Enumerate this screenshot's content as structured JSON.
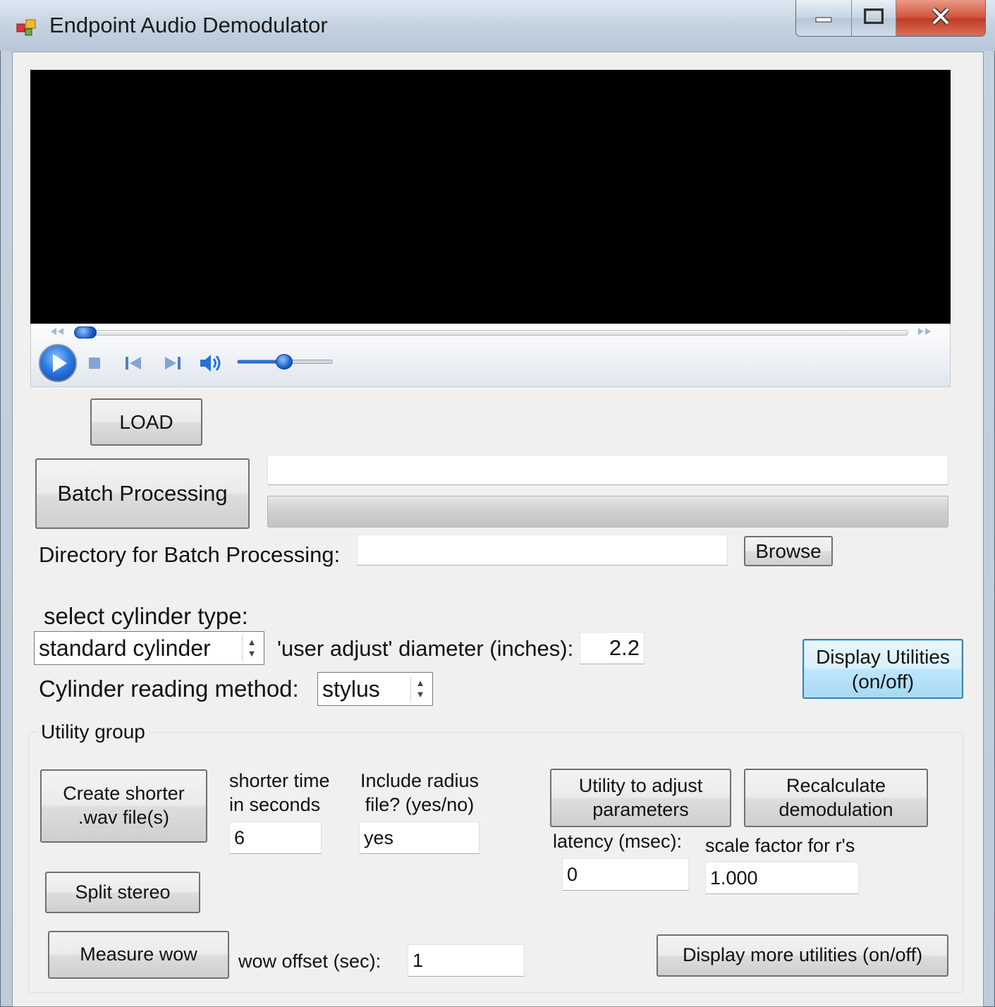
{
  "window": {
    "title": "Endpoint Audio Demodulator",
    "buttons": {
      "minimize": "minimize-icon",
      "maximize": "maximize-icon",
      "close": "close-icon"
    }
  },
  "player": {
    "icons": [
      "rewind-icon",
      "fast-forward-icon",
      "play-icon",
      "stop-icon",
      "previous-icon",
      "next-icon",
      "volume-icon"
    ],
    "seek_level": 0.01,
    "volume_level": 0.5,
    "accent_color": "#1d5fc9"
  },
  "load_button": "LOAD",
  "batch": {
    "button": "Batch Processing",
    "status_value": "",
    "progress_level": 0,
    "directory_label": "Directory for Batch Processing:",
    "directory_value": "",
    "browse_button": "Browse"
  },
  "cylinder": {
    "select_label": "select cylinder type:",
    "type_value": "standard cylinder",
    "diameter_label": "'user adjust' diameter (inches):",
    "diameter_value": "2.2",
    "method_label": "Cylinder reading method:",
    "method_value": "stylus"
  },
  "display_utilities_button": [
    "Display Utilities",
    "(on/off)"
  ],
  "utility_group": {
    "caption": "Utility group",
    "create_shorter_button": [
      "Create shorter",
      ".wav file(s)"
    ],
    "shorter_time_label": [
      "shorter time",
      "in seconds"
    ],
    "shorter_time_value": "6",
    "include_radius_label": [
      "Include radius",
      "file? (yes/no)"
    ],
    "include_radius_value": "yes",
    "adjust_parameters_button": [
      "Utility to adjust",
      "parameters"
    ],
    "recalculate_button": [
      "Recalculate",
      "demodulation"
    ],
    "latency_label": "latency (msec):",
    "latency_value": "0",
    "scale_factor_label": "scale factor for r's",
    "scale_factor_value": "1.000",
    "split_stereo_button": "Split stereo",
    "measure_wow_button": "Measure wow",
    "wow_offset_label": "wow offset (sec):",
    "wow_offset_value": "1",
    "display_more_button": "Display more utilities (on/off)"
  }
}
